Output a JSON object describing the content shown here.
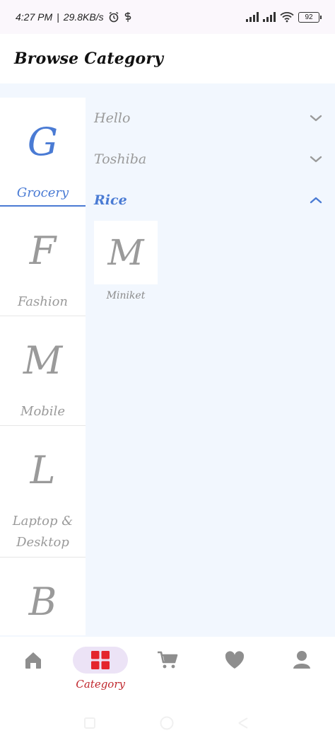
{
  "status_bar": {
    "time": "4:27 PM",
    "speed": "29.8KB/s",
    "battery": "92"
  },
  "app_bar": {
    "title": "Browse Category"
  },
  "categories": [
    {
      "letter": "G",
      "label": "Grocery",
      "active": true
    },
    {
      "letter": "F",
      "label": "Fashion",
      "active": false
    },
    {
      "letter": "M",
      "label": "Mobile",
      "active": false
    },
    {
      "letter": "L",
      "label": "Laptop & Desktop",
      "active": false
    },
    {
      "letter": "B",
      "label": "",
      "active": false
    }
  ],
  "subcategories": [
    {
      "label": "Hello",
      "expanded": false
    },
    {
      "label": "Toshiba",
      "expanded": false
    },
    {
      "label": "Rice",
      "expanded": true
    }
  ],
  "items": [
    {
      "letter": "M",
      "label": "Miniket"
    }
  ],
  "bottom_nav": {
    "category_label": "Category",
    "active_color": "#c0272d",
    "inactive_color": "#8e8e8e"
  },
  "colors": {
    "accent": "#4a7bd4",
    "muted": "#9a9a9a",
    "panel_bg": "#f2f7fe"
  }
}
